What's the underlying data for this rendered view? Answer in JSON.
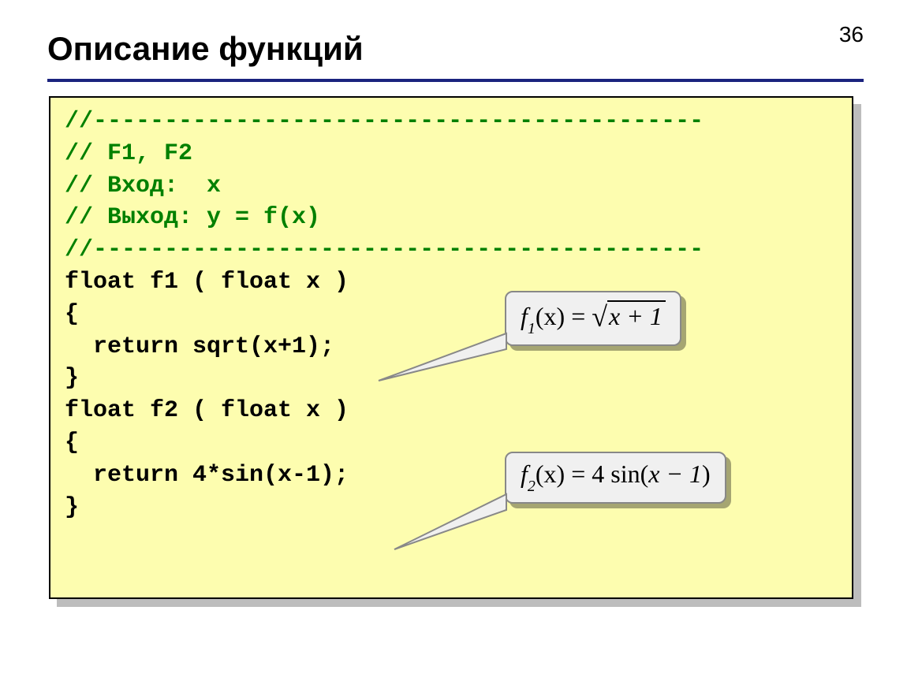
{
  "page_number": "36",
  "title": "Описание функций",
  "code": {
    "comment_lines": [
      "//-------------------------------------------",
      "// F1, F2",
      "// Вход:  x",
      "// Выход: y = f(x)",
      "//-------------------------------------------"
    ],
    "body_lines": [
      "float f1 ( float x )",
      "{",
      "  return sqrt(x+1);",
      "}",
      "float f2 ( float x )",
      "{",
      "  return 4*sin(x-1);",
      "}"
    ]
  },
  "formula1": {
    "fn_letter": "f",
    "sub": "1",
    "arg": "(x) = ",
    "sqrt_sym": "√",
    "radicand": "x + 1"
  },
  "formula2": {
    "fn_letter": "f",
    "sub": "2",
    "arg": "(x) = 4 sin(",
    "inner": "x − 1",
    "close": ")"
  }
}
